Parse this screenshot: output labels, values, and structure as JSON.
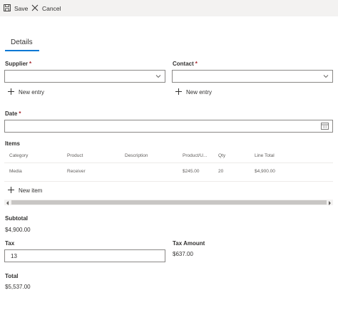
{
  "toolbar": {
    "save_label": "Save",
    "cancel_label": "Cancel"
  },
  "tabs": [
    {
      "label": "Details"
    }
  ],
  "supplier": {
    "label": "Supplier",
    "required": "*",
    "value": "",
    "new_entry": "New entry"
  },
  "contact": {
    "label": "Contact",
    "required": "*",
    "value": "",
    "new_entry": "New entry"
  },
  "date": {
    "label": "Date",
    "required": "*",
    "value": ""
  },
  "items": {
    "label": "Items",
    "columns": [
      "Category",
      "Product",
      "Description",
      "Product/U...",
      "Qty",
      "Line Total"
    ],
    "rows": [
      {
        "category": "Media",
        "product": "Receiver",
        "description": "",
        "unit_price": "$245.00",
        "qty": "20",
        "line_total": "$4,900.00"
      }
    ],
    "new_item": "New item"
  },
  "subtotal": {
    "label": "Subtotal",
    "value": "$4,900.00"
  },
  "tax": {
    "label": "Tax",
    "value": "13"
  },
  "tax_amount": {
    "label": "Tax Amount",
    "value": "$637.00"
  },
  "total": {
    "label": "Total",
    "value": "$5,537.00"
  },
  "colors": {
    "accent": "#0078d4",
    "required": "#a4262c",
    "toolbar_bg": "#f3f2f1"
  }
}
